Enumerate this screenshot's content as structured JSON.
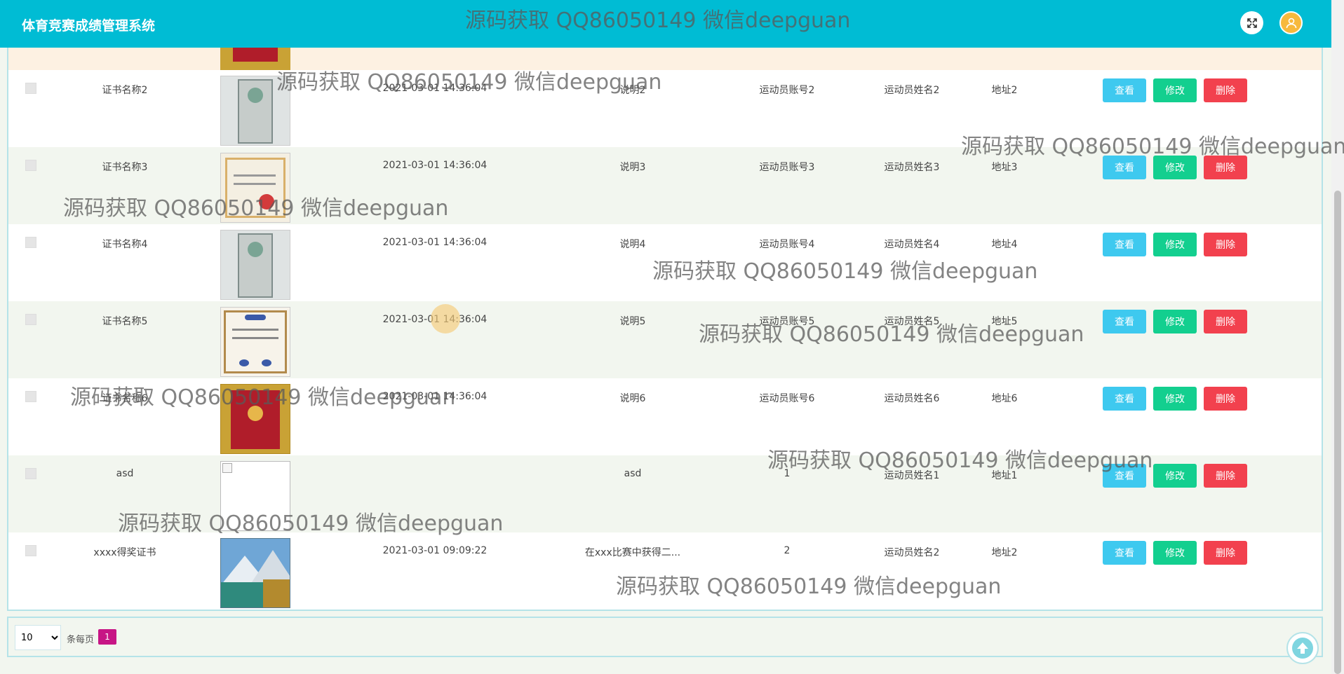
{
  "app": {
    "title": "体育竞赛成绩管理系统"
  },
  "table": {
    "rows": [
      {
        "name": "证书名称2",
        "time": "2021-03-01 14:36:04",
        "desc": "说明2",
        "account": "运动员账号2",
        "athlete": "运动员姓名2",
        "address": "地址2",
        "image": "certificate-green"
      },
      {
        "name": "证书名称3",
        "time": "2021-03-01 14:36:04",
        "desc": "说明3",
        "account": "运动员账号3",
        "athlete": "运动员姓名3",
        "address": "地址3",
        "image": "certificate-white"
      },
      {
        "name": "证书名称4",
        "time": "2021-03-01 14:36:04",
        "desc": "说明4",
        "account": "运动员账号4",
        "athlete": "运动员姓名4",
        "address": "地址4",
        "image": "certificate-green"
      },
      {
        "name": "证书名称5",
        "time": "2021-03-01 14:36:04",
        "desc": "说明5",
        "account": "运动员账号5",
        "athlete": "运动员姓名5",
        "address": "地址5",
        "image": "certificate-award"
      },
      {
        "name": "证书名称6",
        "time": "2021-03-01 14:36:04",
        "desc": "说明6",
        "account": "运动员账号6",
        "athlete": "运动员姓名6",
        "address": "地址6",
        "image": "certificate-red"
      },
      {
        "name": "asd",
        "time": "",
        "desc": "asd",
        "account": "1",
        "athlete": "运动员姓名1",
        "address": "地址1",
        "image": "broken"
      },
      {
        "name": "xxxx得奖证书",
        "time": "2021-03-01 09:09:22",
        "desc": "在xxx比赛中获得二...",
        "account": "2",
        "athlete": "运动员姓名2",
        "address": "地址2",
        "image": "landscape"
      }
    ],
    "actions": {
      "view": "查看",
      "edit": "修改",
      "delete": "删除"
    }
  },
  "pagination": {
    "page_size": "10",
    "per_page_label": "条每页",
    "current_page": "1"
  },
  "watermark": {
    "text": "源码获取 QQ86050149 微信deepguan"
  },
  "colors": {
    "header": "#00bcd4",
    "view_button": "#3ec9ef",
    "edit_button": "#13cf8f",
    "delete_button": "#f2414e",
    "active_page": "#c71585"
  }
}
